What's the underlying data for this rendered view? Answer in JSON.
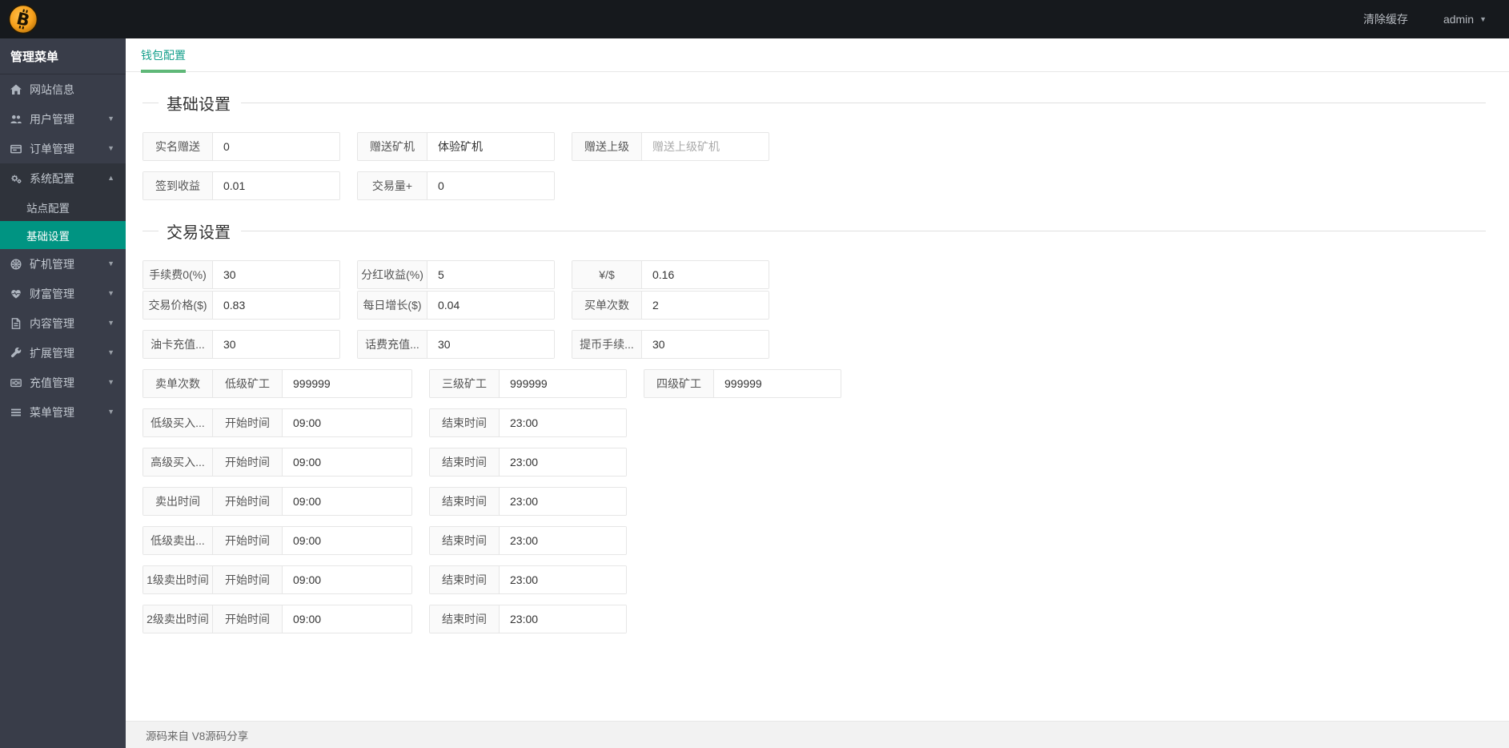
{
  "topbar": {
    "logo_icon": "bitcoin-coin-icon",
    "clear_cache_label": "清除缓存",
    "user_name": "admin"
  },
  "sidebar": {
    "header": "管理菜单",
    "items": [
      {
        "label": "网站信息",
        "icon": "home-icon",
        "expandable": false
      },
      {
        "label": "用户管理",
        "icon": "users-icon",
        "expandable": true
      },
      {
        "label": "订单管理",
        "icon": "orders-icon",
        "expandable": true
      },
      {
        "label": "系统配置",
        "icon": "gears-icon",
        "expandable": true,
        "expanded": true,
        "children": [
          {
            "label": "站点配置",
            "active": false
          },
          {
            "label": "基础设置",
            "active": true
          }
        ]
      },
      {
        "label": "矿机管理",
        "icon": "wheel-icon",
        "expandable": true
      },
      {
        "label": "财富管理",
        "icon": "heartbeat-icon",
        "expandable": true
      },
      {
        "label": "内容管理",
        "icon": "file-icon",
        "expandable": true
      },
      {
        "label": "扩展管理",
        "icon": "wrench-icon",
        "expandable": true
      },
      {
        "label": "充值管理",
        "icon": "money-icon",
        "expandable": true
      },
      {
        "label": "菜单管理",
        "icon": "bars-icon",
        "expandable": true
      }
    ]
  },
  "tab": {
    "label": "钱包配置"
  },
  "sections": [
    {
      "title": "基础设置",
      "rows": [
        {
          "fields": [
            {
              "labels": [
                "实名赠送"
              ],
              "value": "0"
            },
            {
              "labels": [
                "赠送矿机"
              ],
              "value": "体验矿机"
            },
            {
              "labels": [
                "赠送上级"
              ],
              "value": "",
              "placeholder": "赠送上级矿机"
            }
          ]
        },
        {
          "fields": [
            {
              "labels": [
                "签到收益"
              ],
              "value": "0.01"
            },
            {
              "labels": [
                "交易量+"
              ],
              "value": "0"
            }
          ]
        }
      ]
    },
    {
      "title": "交易设置",
      "rows": [
        {
          "tight": true,
          "fields": [
            {
              "labels": [
                "手续费0(%)"
              ],
              "value": "30"
            },
            {
              "labels": [
                "分红收益(%)"
              ],
              "value": "5"
            },
            {
              "labels": [
                "¥/$"
              ],
              "value": "0.16"
            }
          ]
        },
        {
          "fields": [
            {
              "labels": [
                "交易价格($)"
              ],
              "value": "0.83"
            },
            {
              "labels": [
                "每日增长($)"
              ],
              "value": "0.04"
            },
            {
              "labels": [
                "买单次数"
              ],
              "value": "2"
            }
          ]
        },
        {
          "fields": [
            {
              "labels": [
                "油卡充值..."
              ],
              "value": "30"
            },
            {
              "labels": [
                "话费充值..."
              ],
              "value": "30"
            },
            {
              "labels": [
                "提币手续..."
              ],
              "value": "30"
            }
          ]
        },
        {
          "fields": [
            {
              "labels": [
                "卖单次数",
                "低级矿工"
              ],
              "value": "999999"
            },
            {
              "labels": [
                "三级矿工"
              ],
              "value": "999999"
            },
            {
              "labels": [
                "四级矿工"
              ],
              "value": "999999"
            }
          ]
        },
        {
          "fields": [
            {
              "labels": [
                "低级买入...",
                "开始时间"
              ],
              "value": "09:00"
            },
            {
              "labels": [
                "结束时间"
              ],
              "value": "23:00"
            }
          ]
        },
        {
          "fields": [
            {
              "labels": [
                "高级买入...",
                "开始时间"
              ],
              "value": "09:00"
            },
            {
              "labels": [
                "结束时间"
              ],
              "value": "23:00"
            }
          ]
        },
        {
          "fields": [
            {
              "labels": [
                "卖出时间",
                "开始时间"
              ],
              "value": "09:00"
            },
            {
              "labels": [
                "结束时间"
              ],
              "value": "23:00"
            }
          ]
        },
        {
          "fields": [
            {
              "labels": [
                "低级卖出...",
                "开始时间"
              ],
              "value": "09:00"
            },
            {
              "labels": [
                "结束时间"
              ],
              "value": "23:00"
            }
          ]
        },
        {
          "fields": [
            {
              "labels": [
                "1级卖出时间",
                "开始时间"
              ],
              "value": "09:00"
            },
            {
              "labels": [
                "结束时间"
              ],
              "value": "23:00"
            }
          ]
        },
        {
          "fields": [
            {
              "labels": [
                "2级卖出时间",
                "开始时间"
              ],
              "value": "09:00"
            },
            {
              "labels": [
                "结束时间"
              ],
              "value": "23:00"
            }
          ]
        }
      ]
    }
  ],
  "footer": {
    "text": "源码来自 V8源码分享"
  },
  "colors": {
    "topbar_bg": "#16191d",
    "sidebar_bg": "#393d49",
    "submenu_bg": "#2f333b",
    "active_teal": "#009482",
    "tab_text": "#16a08c",
    "tab_underline": "#5FB878",
    "logo_gold": "#f7a01b"
  }
}
